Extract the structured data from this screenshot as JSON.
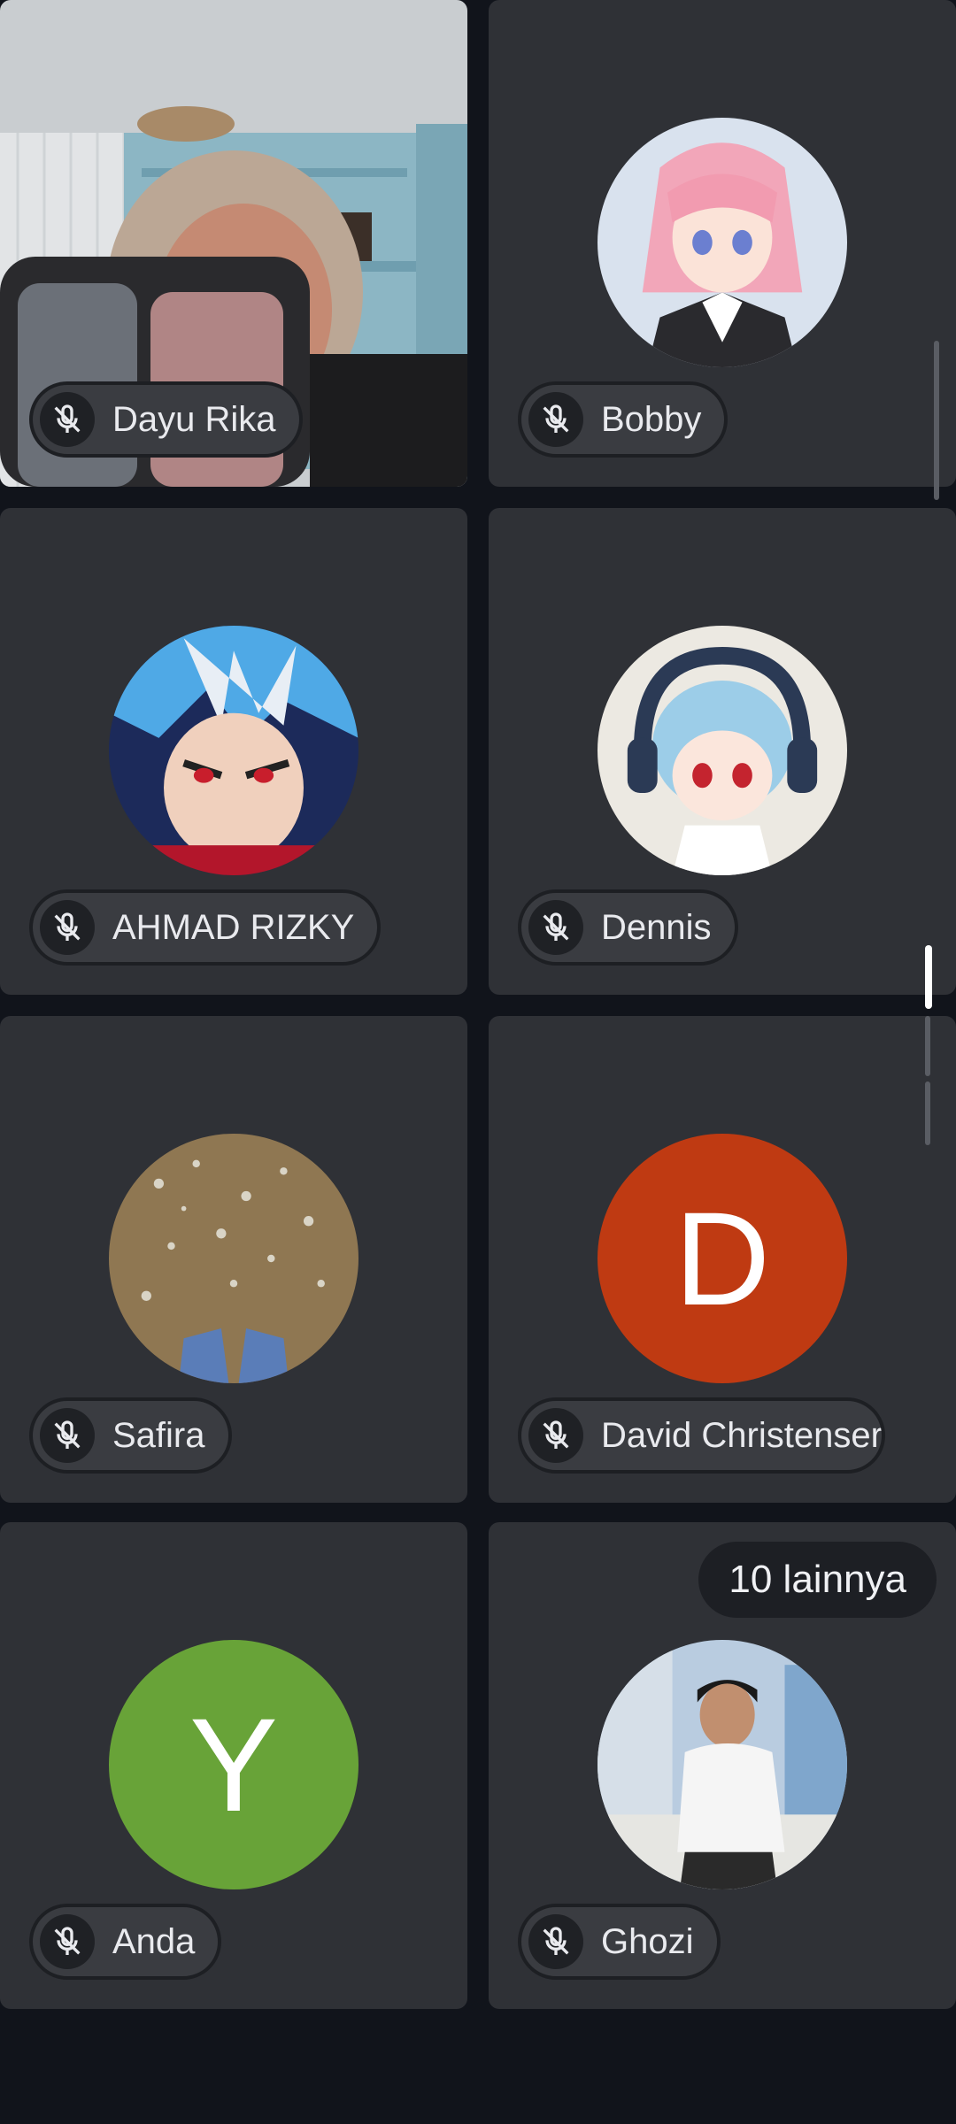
{
  "participants": [
    {
      "name": "Dayu Rika",
      "muted": true,
      "type": "video"
    },
    {
      "name": "Bobby",
      "muted": true,
      "type": "image",
      "icon": "anime-girl-pink-hair-avatar"
    },
    {
      "name": "AHMAD RIZKY",
      "muted": true,
      "type": "image",
      "icon": "anime-boy-blue-hair-avatar"
    },
    {
      "name": "Dennis",
      "muted": true,
      "type": "image",
      "icon": "anime-figure-headphones-avatar"
    },
    {
      "name": "Safira",
      "muted": true,
      "type": "image",
      "icon": "sand-feet-photo-avatar"
    },
    {
      "name": "David Christenser",
      "muted": true,
      "type": "letter",
      "letter": "D",
      "color": "#bf3a12"
    },
    {
      "name": "Anda",
      "muted": true,
      "type": "letter",
      "letter": "Y",
      "color": "#68a338"
    },
    {
      "name": "Ghozi",
      "muted": true,
      "type": "image",
      "icon": "young-man-photo-avatar"
    }
  ],
  "more_badge": "10 lainnya",
  "colors": {
    "background": "#11141b",
    "tile": "#2f3136",
    "pill": "#3a3c41",
    "text": "#e9eaee"
  }
}
